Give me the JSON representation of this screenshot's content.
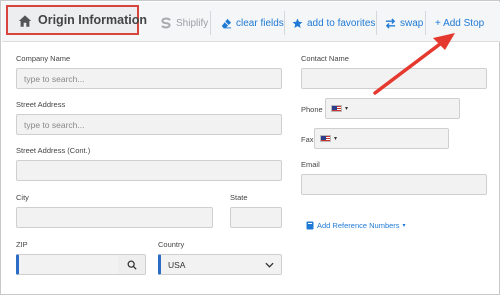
{
  "header": {
    "title": "Origin Information",
    "toolbar": {
      "shiplify": "Shiplify",
      "clear_fields": "clear fields",
      "add_to_favorites": "add to favorites",
      "swap": "swap",
      "add_stop": "+ Add Stop"
    }
  },
  "form": {
    "company_name": {
      "label": "Company Name",
      "placeholder": "type to search..."
    },
    "street_address": {
      "label": "Street Address",
      "placeholder": "type to search..."
    },
    "street_address_cont": {
      "label": "Street Address (Cont.)"
    },
    "city": {
      "label": "City"
    },
    "state": {
      "label": "State"
    },
    "zip": {
      "label": "ZIP"
    },
    "country": {
      "label": "Country",
      "value": "USA"
    },
    "contact_name": {
      "label": "Contact Name"
    },
    "phone": {
      "label": "Phone"
    },
    "fax": {
      "label": "Fax"
    },
    "email": {
      "label": "Email"
    },
    "reference_numbers_link": "Add Reference Numbers"
  },
  "colors": {
    "accent": "#1f7ad6",
    "highlight_border": "#d9443c",
    "arrow": "#e5392f",
    "input_bg": "#f2f2f2",
    "required_edge": "#2b6cc4"
  },
  "icons": {
    "title": "home-icon",
    "shiplify": "shiplify-logo-icon",
    "clear": "eraser-icon",
    "favorites": "star-icon",
    "swap": "swap-arrows-icon",
    "zip_search": "search-icon",
    "reference": "book-icon",
    "country_dropdown": "chevron-down-icon",
    "phone_flag": "us-flag-icon"
  }
}
